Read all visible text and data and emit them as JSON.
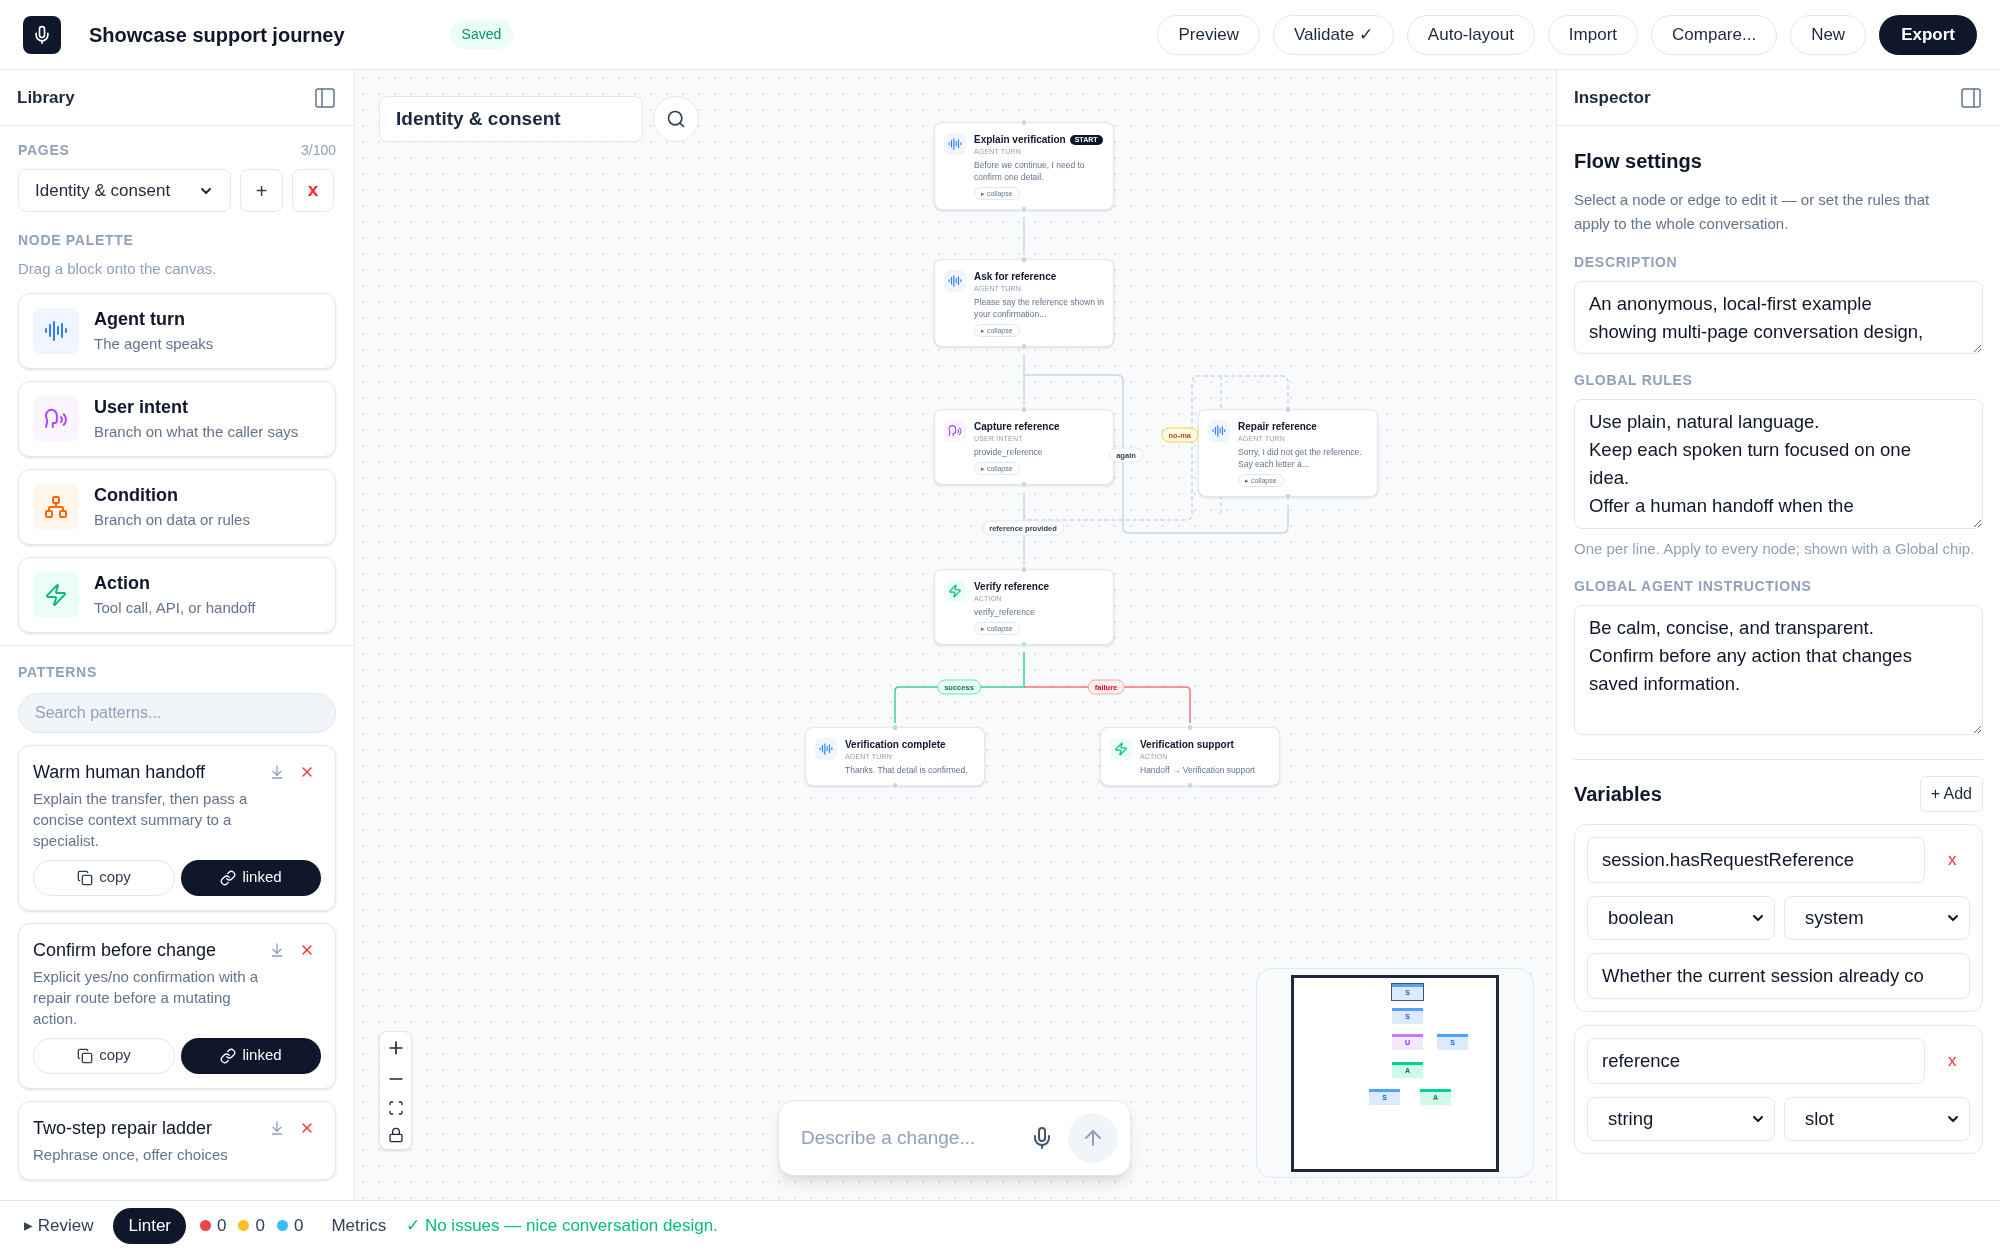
{
  "header": {
    "title": "Showcase support journey",
    "status": "Saved",
    "buttons": [
      {
        "label": "Preview",
        "kind": "outline"
      },
      {
        "label": "Validate ✓",
        "kind": "outline"
      },
      {
        "label": "Auto-layout",
        "kind": "outline"
      },
      {
        "label": "Import",
        "kind": "outline"
      },
      {
        "label": "Compare...",
        "kind": "outline"
      },
      {
        "label": "New",
        "kind": "outline"
      },
      {
        "label": "Export",
        "kind": "primary"
      }
    ]
  },
  "library": {
    "title": "Library",
    "pages_label": "PAGES",
    "pages_count": "3/100",
    "page_select": "Identity & consent",
    "add_button": "+",
    "delete_button": "x",
    "palette_label": "NODE PALETTE",
    "palette_hint": "Drag a block onto the canvas.",
    "palette": [
      {
        "kind": "agent",
        "title": "Agent turn",
        "subtitle": "The agent speaks"
      },
      {
        "kind": "intent",
        "title": "User intent",
        "subtitle": "Branch on what the caller says"
      },
      {
        "kind": "condition",
        "title": "Condition",
        "subtitle": "Branch on data or rules"
      },
      {
        "kind": "action",
        "title": "Action",
        "subtitle": "Tool call, API, or handoff"
      }
    ],
    "patterns_label": "PATTERNS",
    "patterns_search": {
      "placeholder": "Search patterns..."
    },
    "patterns": [
      {
        "title": "Warm human handoff",
        "description": "Explain the transfer, then pass a concise context summary to a specialist.",
        "copy": "copy",
        "link": "linked"
      },
      {
        "title": "Confirm before change",
        "description": "Explicit yes/no confirmation with a repair route before a mutating action.",
        "copy": "copy",
        "link": "linked"
      },
      {
        "title": "Two-step repair ladder",
        "description": "Rephrase once, offer choices"
      }
    ]
  },
  "canvas": {
    "page_title": "Identity & consent",
    "nodes": [
      {
        "kind": "agent",
        "title": "Explain verification",
        "badge": "START",
        "type_label": "AGENT TURN",
        "body": "Before we continue, I need to confirm one detail.",
        "collapse": "▸ collapse"
      },
      {
        "kind": "agent",
        "title": "Ask for reference",
        "type_label": "AGENT TURN",
        "body": "Please say the reference shown in your confirmation...",
        "collapse": "▸ collapse"
      },
      {
        "kind": "intent",
        "title": "Capture reference",
        "type_label": "USER INTENT",
        "body": "provide_reference",
        "collapse": "▸ collapse"
      },
      {
        "kind": "agent",
        "title": "Repair reference",
        "type_label": "AGENT TURN",
        "body": "Sorry, I did not get the reference. Say each letter a...",
        "collapse": "▸ collapse"
      },
      {
        "kind": "action",
        "title": "Verify reference",
        "type_label": "ACTION",
        "body": "verify_reference",
        "collapse": "▸ collapse"
      },
      {
        "kind": "agent",
        "title": "Verification complete",
        "type_label": "AGENT TURN",
        "body": "Thanks. That detail is confirmed."
      },
      {
        "kind": "action",
        "title": "Verification support",
        "type_label": "ACTION",
        "body": "Handoff → Verification support"
      }
    ],
    "edge_labels": [
      {
        "text": "again",
        "kind": "neutral"
      },
      {
        "text": "no-ma",
        "kind": "warning"
      },
      {
        "text": "reference provided",
        "kind": "neutral"
      },
      {
        "text": "success",
        "kind": "success"
      },
      {
        "text": "failure",
        "kind": "danger"
      }
    ],
    "minimap": [
      {
        "kind": "agent",
        "letter": "S",
        "selected": true
      },
      {
        "kind": "agent",
        "letter": "S",
        "selected": false
      },
      {
        "kind": "intent",
        "letter": "U",
        "selected": false
      },
      {
        "kind": "agent",
        "letter": "S",
        "selected": false
      },
      {
        "kind": "action",
        "letter": "A",
        "selected": false
      },
      {
        "kind": "agent",
        "letter": "S",
        "selected": false
      },
      {
        "kind": "action",
        "letter": "A",
        "selected": false
      }
    ],
    "prompt": {
      "placeholder": "Describe a change..."
    }
  },
  "inspector": {
    "title": "Inspector",
    "heading": "Flow settings",
    "intro": "Select a node or edge to edit it — or set the rules that apply to the whole conversation.",
    "fields": [
      {
        "label": "DESCRIPTION",
        "value": "An anonymous, local-first example showing multi-page conversation design,",
        "kind": "short"
      },
      {
        "label": "GLOBAL RULES",
        "value": "Use plain, natural language.\nKeep each spoken turn focused on one idea.\nOffer a human handoff when the",
        "kind": "tall",
        "hint": "One per line. Apply to every node; shown with a Global chip."
      },
      {
        "label": "GLOBAL AGENT INSTRUCTIONS",
        "value": "Be calm, concise, and transparent.\nConfirm before any action that changes saved information.",
        "kind": "tall"
      }
    ],
    "variables_title": "Variables",
    "add_button": "+ Add",
    "variables": [
      {
        "name": "session.hasRequestReference",
        "remove": "x",
        "type": "boolean",
        "scope": "system",
        "description": "Whether the current session already co"
      },
      {
        "name": "reference",
        "remove": "x",
        "type": "string",
        "scope": "slot"
      }
    ]
  },
  "status_bar": {
    "review": "▸ Review",
    "linter": "Linter",
    "counts": [
      {
        "color": "#ef4444",
        "count": "0"
      },
      {
        "color": "#fbbf24",
        "count": "0"
      },
      {
        "color": "#38bdf8",
        "count": "0"
      }
    ],
    "metrics": "Metrics",
    "message": "✓ No issues — nice conversation design."
  }
}
